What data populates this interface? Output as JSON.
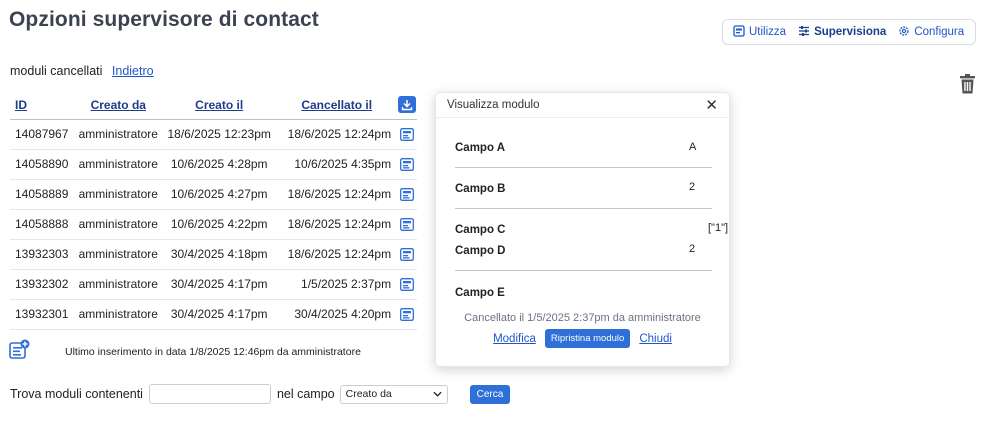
{
  "page_title": "Opzioni supervisore di contact",
  "topnav": {
    "items": [
      {
        "label": "Utilizza",
        "icon": "form-icon"
      },
      {
        "label": "Supervisiona",
        "icon": "sliders-icon",
        "active": true
      },
      {
        "label": "Configura",
        "icon": "gear-icon"
      }
    ]
  },
  "subhead": {
    "text": "moduli cancellati",
    "back_link": "Indietro"
  },
  "table": {
    "headers": {
      "id": "ID",
      "created_by": "Creato da",
      "created_at": "Creato il",
      "deleted_at": "Cancellato il"
    },
    "rows": [
      {
        "id": "14087967",
        "created_by": "amministratore",
        "created_at": "18/6/2025 12:23pm",
        "deleted_at": "18/6/2025 12:24pm"
      },
      {
        "id": "14058890",
        "created_by": "amministratore",
        "created_at": "10/6/2025 4:28pm",
        "deleted_at": "10/6/2025 4:35pm"
      },
      {
        "id": "14058889",
        "created_by": "amministratore",
        "created_at": "10/6/2025 4:27pm",
        "deleted_at": "18/6/2025 12:24pm"
      },
      {
        "id": "14058888",
        "created_by": "amministratore",
        "created_at": "10/6/2025 4:22pm",
        "deleted_at": "18/6/2025 12:24pm"
      },
      {
        "id": "13932303",
        "created_by": "amministratore",
        "created_at": "30/4/2025 4:18pm",
        "deleted_at": "18/6/2025 12:24pm"
      },
      {
        "id": "13932302",
        "created_by": "amministratore",
        "created_at": "30/4/2025 4:17pm",
        "deleted_at": "1/5/2025 2:37pm"
      },
      {
        "id": "13932301",
        "created_by": "amministratore",
        "created_at": "30/4/2025 4:17pm",
        "deleted_at": "30/4/2025 4:20pm"
      }
    ]
  },
  "last_insert": "Ultimo inserimento in data 1/8/2025 12:46pm da amministratore",
  "search": {
    "label": "Trova moduli contenenti",
    "input_value": "",
    "field_label": "nel campo",
    "select_value": "Creato da",
    "button": "Cerca"
  },
  "modal": {
    "title": "Visualizza modulo",
    "fields": [
      {
        "key": "Campo A",
        "value": "A"
      },
      {
        "key": "Campo B",
        "value": "2"
      },
      {
        "key": "Campo C",
        "value": "[\"1\"]"
      },
      {
        "key": "Campo D",
        "value": "2"
      },
      {
        "key": "Campo E",
        "value": ""
      }
    ],
    "cancel_info": "Cancellato il 1/5/2025 2:37pm da amministratore",
    "actions": {
      "edit": "Modifica",
      "restore": "Ripristina modulo",
      "close": "Chiudi"
    }
  },
  "colors": {
    "accent": "#2f6fd8",
    "title": "#3c4250",
    "link": "#1f56c9"
  }
}
